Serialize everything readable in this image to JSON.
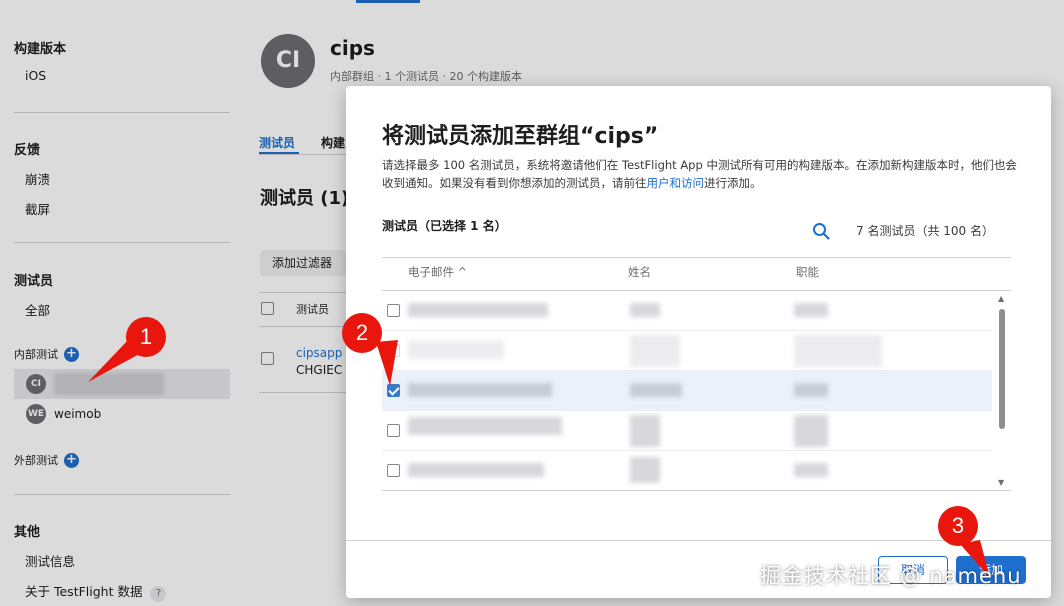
{
  "sidebar": {
    "build_header": "构建版本",
    "build_items": [
      "iOS"
    ],
    "feedback_header": "反馈",
    "feedback_items": [
      "崩溃",
      "截屏"
    ],
    "testers_header": "测试员",
    "testers_all": "全部",
    "internal_label": "内部测试",
    "internal_groups": [
      {
        "initials": "CI",
        "name": ""
      },
      {
        "initials": "WE",
        "name": "weimob"
      }
    ],
    "external_label": "外部测试",
    "other_header": "其他",
    "other_items": [
      "测试信息",
      "关于 TestFlight 数据"
    ],
    "help_glyph": "?"
  },
  "main": {
    "group_initials": "CI",
    "group_name": "cips",
    "group_meta": "内部群组 · 1 个测试员 · 20 个构建版本",
    "tabs": [
      "测试员",
      "构建"
    ],
    "section_title": "测试员 (1)",
    "filter_button": "添加过滤器",
    "column_testers": "测试员",
    "tester_link": "cipsapp",
    "tester_sub": "CHGIEC"
  },
  "modal": {
    "title": "将测试员添加至群组“cips”",
    "description_pre": "请选择最多 100 名测试员，系统将邀请他们在 TestFlight App 中测试所有可用的构建版本。在添加新构建版本时，他们也会收到通知。如果没有看到你想添加的测试员，请前往",
    "description_link": "用户和访问",
    "description_post": "进行添加。",
    "selected_label": "测试员（已选择 1 名）",
    "count_label": "7 名测试员（共 100 名）",
    "columns": {
      "email": "电子邮件 ^",
      "name": "姓名",
      "role": "职能"
    },
    "rows": [
      {
        "checked": false
      },
      {
        "checked": false,
        "disabled": true
      },
      {
        "checked": true
      },
      {
        "checked": false
      },
      {
        "checked": false
      }
    ],
    "cancel_button": "取消",
    "add_button": "添加"
  },
  "markers": [
    "1",
    "2",
    "3"
  ],
  "watermark": "掘金技术社区 @ namehu",
  "colors": {
    "accent": "#1f6fcf",
    "marker": "#e8160c"
  }
}
